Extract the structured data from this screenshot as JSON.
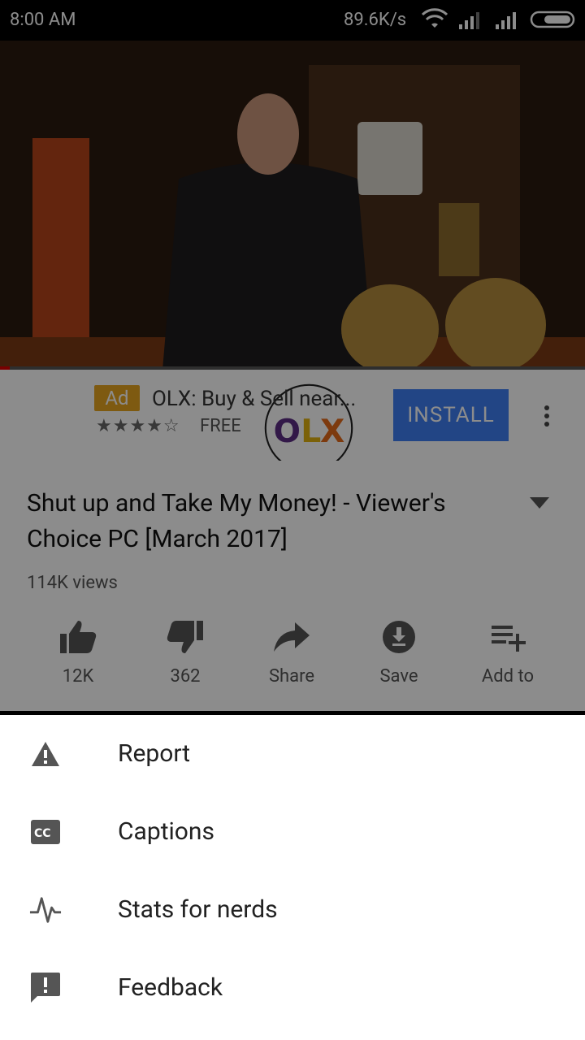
{
  "status_bar": {
    "time": "8:00 AM",
    "speed": "89.6K/s",
    "icons": [
      "wifi-icon",
      "signal-icon",
      "signal-icon",
      "battery-icon"
    ]
  },
  "video": {
    "description_icon": "video-thumbnail"
  },
  "ad": {
    "badge": "Ad",
    "title": "OLX: Buy & Sell near...",
    "stars": "★★★★☆",
    "price": "FREE",
    "install_label": "INSTALL",
    "logo_text": "OLX"
  },
  "video_info": {
    "title": "Shut up and Take My Money! - Viewer's Choice PC [March 2017]",
    "views": "114K views"
  },
  "actions": [
    {
      "label": "12K",
      "icon": "thumb-up-icon"
    },
    {
      "label": "362",
      "icon": "thumb-down-icon"
    },
    {
      "label": "Share",
      "icon": "share-icon"
    },
    {
      "label": "Save",
      "icon": "download-icon"
    },
    {
      "label": "Add to",
      "icon": "playlist-add-icon"
    }
  ],
  "menu": [
    {
      "label": "Report",
      "icon": "warning-icon"
    },
    {
      "label": "Captions",
      "icon": "captions-icon"
    },
    {
      "label": "Stats for nerds",
      "icon": "pulse-icon"
    },
    {
      "label": "Feedback",
      "icon": "feedback-icon"
    }
  ],
  "colors": {
    "accent_install": "#3f7ff2",
    "ad_badge": "#e6a51f",
    "progress": "#dd0000"
  }
}
